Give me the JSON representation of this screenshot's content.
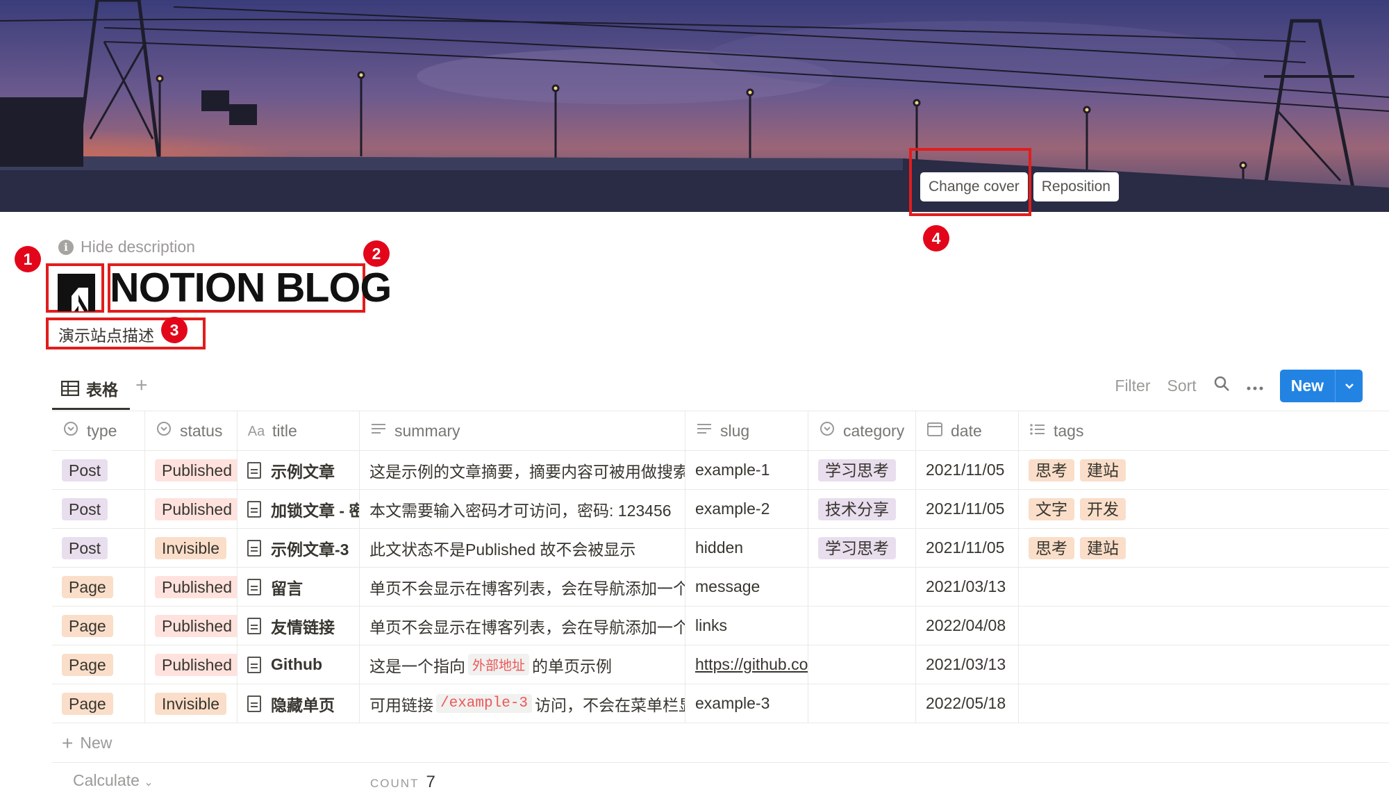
{
  "cover": {
    "change_label": "Change cover",
    "reposition_label": "Reposition"
  },
  "annotations": [
    "1",
    "2",
    "3",
    "4"
  ],
  "header": {
    "hide_description": "Hide description",
    "title": "NOTION BLOG",
    "description": "演示站点描述"
  },
  "view": {
    "tab_label": "表格",
    "add": "+"
  },
  "toolbar": {
    "filter": "Filter",
    "sort": "Sort",
    "new": "New"
  },
  "columns": [
    {
      "label": "type",
      "icon": "status-icon"
    },
    {
      "label": "status",
      "icon": "status-icon"
    },
    {
      "label": "title",
      "icon": "text-icon"
    },
    {
      "label": "summary",
      "icon": "lines-icon"
    },
    {
      "label": "slug",
      "icon": "lines-icon"
    },
    {
      "label": "category",
      "icon": "status-icon"
    },
    {
      "label": "date",
      "icon": "calendar-icon"
    },
    {
      "label": "tags",
      "icon": "list-icon"
    }
  ],
  "rows": [
    {
      "type": "Post",
      "status": "Published",
      "title": "示例文章",
      "summary": "这是示例的文章摘要，摘要内容可被用做搜索，预览。文",
      "slug": "example-1",
      "category": "学习思考",
      "date": "2021/11/05",
      "tags": [
        "思考",
        "建站"
      ]
    },
    {
      "type": "Post",
      "status": "Published",
      "title": "加锁文章 - 密码",
      "summary": "本文需要输入密码才可访问，密码: 123456",
      "slug": "example-2",
      "category": "技术分享",
      "date": "2021/11/05",
      "tags": [
        "文字",
        "开发"
      ]
    },
    {
      "type": "Post",
      "status": "Invisible",
      "title": "示例文章-3",
      "summary": "此文状态不是Published 故不会被显示",
      "slug": "hidden",
      "category": "学习思考",
      "date": "2021/11/05",
      "tags": [
        "思考",
        "建站"
      ]
    },
    {
      "type": "Page",
      "status": "Published",
      "title": "留言",
      "summary": "单页不会显示在博客列表，会在导航添加一个菜单。",
      "slug": "message",
      "category": "",
      "date": "2021/03/13",
      "tags": []
    },
    {
      "type": "Page",
      "status": "Published",
      "title": "友情链接",
      "summary": "单页不会显示在博客列表，会在导航添加一个菜单。",
      "slug": "links",
      "category": "",
      "date": "2022/04/08",
      "tags": []
    },
    {
      "type": "Page",
      "status": "Published",
      "title": "Github",
      "summary_pre": "这是一个指向",
      "summary_code": "外部地址",
      "summary_post": "的单页示例",
      "slug": "https://github.com/",
      "category": "",
      "date": "2021/03/13",
      "tags": []
    },
    {
      "type": "Page",
      "status": "Invisible",
      "title": "隐藏单页",
      "summary_pre": "可用链接",
      "summary_code": "/example-3",
      "summary_post": "访问，不会在菜单栏显示",
      "slug": "example-3",
      "category": "",
      "date": "2022/05/18",
      "tags": []
    }
  ],
  "footer": {
    "new_row": "New",
    "calculate": "Calculate",
    "count_label": "COUNT",
    "count_value": "7"
  },
  "colors": {
    "post_tag": "#e8deee",
    "page_tag": "#fadec9",
    "published_tag": "#ffe2dd",
    "invisible_tag": "#fadec9",
    "category_tag": "#e8deee",
    "tag_bg": "#fadec9",
    "accent": "#2383e2",
    "annotation": "#e3061a"
  }
}
